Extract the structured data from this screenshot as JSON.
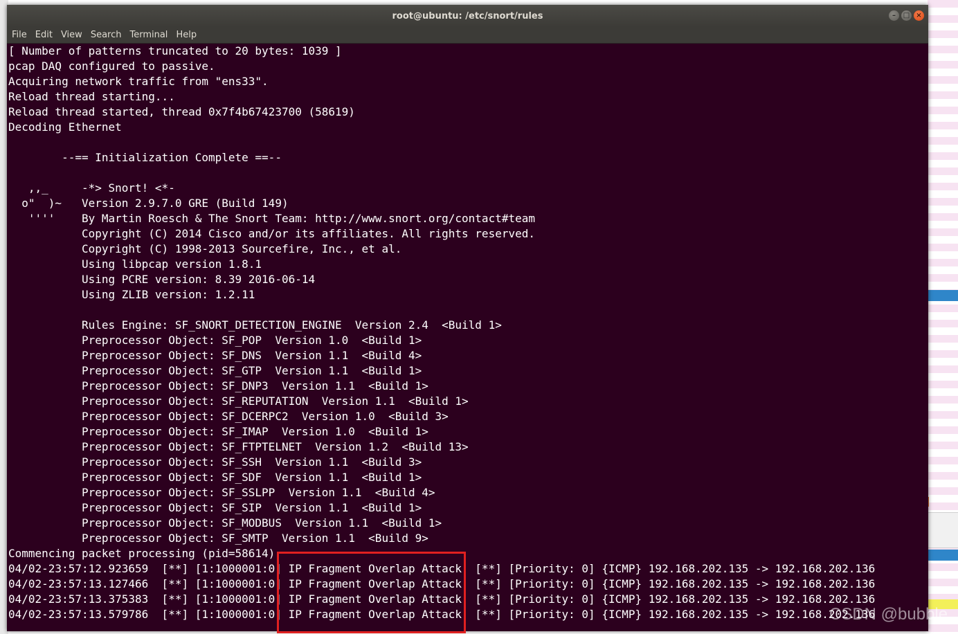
{
  "window": {
    "title": "root@ubuntu: /etc/snort/rules",
    "buttons": {
      "minimize": "–",
      "maximize": "□",
      "close": "×"
    }
  },
  "menu": [
    "File",
    "Edit",
    "View",
    "Search",
    "Terminal",
    "Help"
  ],
  "terminal_lines": [
    "[ Number of patterns truncated to 20 bytes: 1039 ]",
    "pcap DAQ configured to passive.",
    "Acquiring network traffic from \"ens33\".",
    "Reload thread starting...",
    "Reload thread started, thread 0x7f4b67423700 (58619)",
    "Decoding Ethernet",
    "",
    "        --== Initialization Complete ==--",
    "",
    "   ,,_     -*> Snort! <*-",
    "  o\"  )~   Version 2.9.7.0 GRE (Build 149)",
    "   ''''    By Martin Roesch & The Snort Team: http://www.snort.org/contact#team",
    "           Copyright (C) 2014 Cisco and/or its affiliates. All rights reserved.",
    "           Copyright (C) 1998-2013 Sourcefire, Inc., et al.",
    "           Using libpcap version 1.8.1",
    "           Using PCRE version: 8.39 2016-06-14",
    "           Using ZLIB version: 1.2.11",
    "",
    "           Rules Engine: SF_SNORT_DETECTION_ENGINE  Version 2.4  <Build 1>",
    "           Preprocessor Object: SF_POP  Version 1.0  <Build 1>",
    "           Preprocessor Object: SF_DNS  Version 1.1  <Build 4>",
    "           Preprocessor Object: SF_GTP  Version 1.1  <Build 1>",
    "           Preprocessor Object: SF_DNP3  Version 1.1  <Build 1>",
    "           Preprocessor Object: SF_REPUTATION  Version 1.1  <Build 1>",
    "           Preprocessor Object: SF_DCERPC2  Version 1.0  <Build 3>",
    "           Preprocessor Object: SF_IMAP  Version 1.0  <Build 1>",
    "           Preprocessor Object: SF_FTPTELNET  Version 1.2  <Build 13>",
    "           Preprocessor Object: SF_SSH  Version 1.1  <Build 3>",
    "           Preprocessor Object: SF_SDF  Version 1.1  <Build 1>",
    "           Preprocessor Object: SF_SSLPP  Version 1.1  <Build 4>",
    "           Preprocessor Object: SF_SIP  Version 1.1  <Build 1>",
    "           Preprocessor Object: SF_MODBUS  Version 1.1  <Build 1>",
    "           Preprocessor Object: SF_SMTP  Version 1.1  <Build 9>",
    "Commencing packet processing (pid=58614)",
    "04/02-23:57:12.923659  [**] [1:1000001:0] IP Fragment Overlap Attack! [**] [Priority: 0] {ICMP} 192.168.202.135 -> 192.168.202.136",
    "04/02-23:57:13.127466  [**] [1:1000001:0] IP Fragment Overlap Attack! [**] [Priority: 0] {ICMP} 192.168.202.135 -> 192.168.202.136",
    "04/02-23:57:13.375383  [**] [1:1000001:0] IP Fragment Overlap Attack! [**] [Priority: 0] {ICMP} 192.168.202.135 -> 192.168.202.136",
    "04/02-23:57:13.579786  [**] [1:1000001:0] IP Fragment Overlap Attack! [**] [Priority: 0] {ICMP} 192.168.202.135 -> 192.168.202.136"
  ],
  "watermark": "CSDN @bubble",
  "colors": {
    "terminal_bg": "#2c001e",
    "terminal_fg": "#ffffff",
    "highlight": "#e02020"
  }
}
